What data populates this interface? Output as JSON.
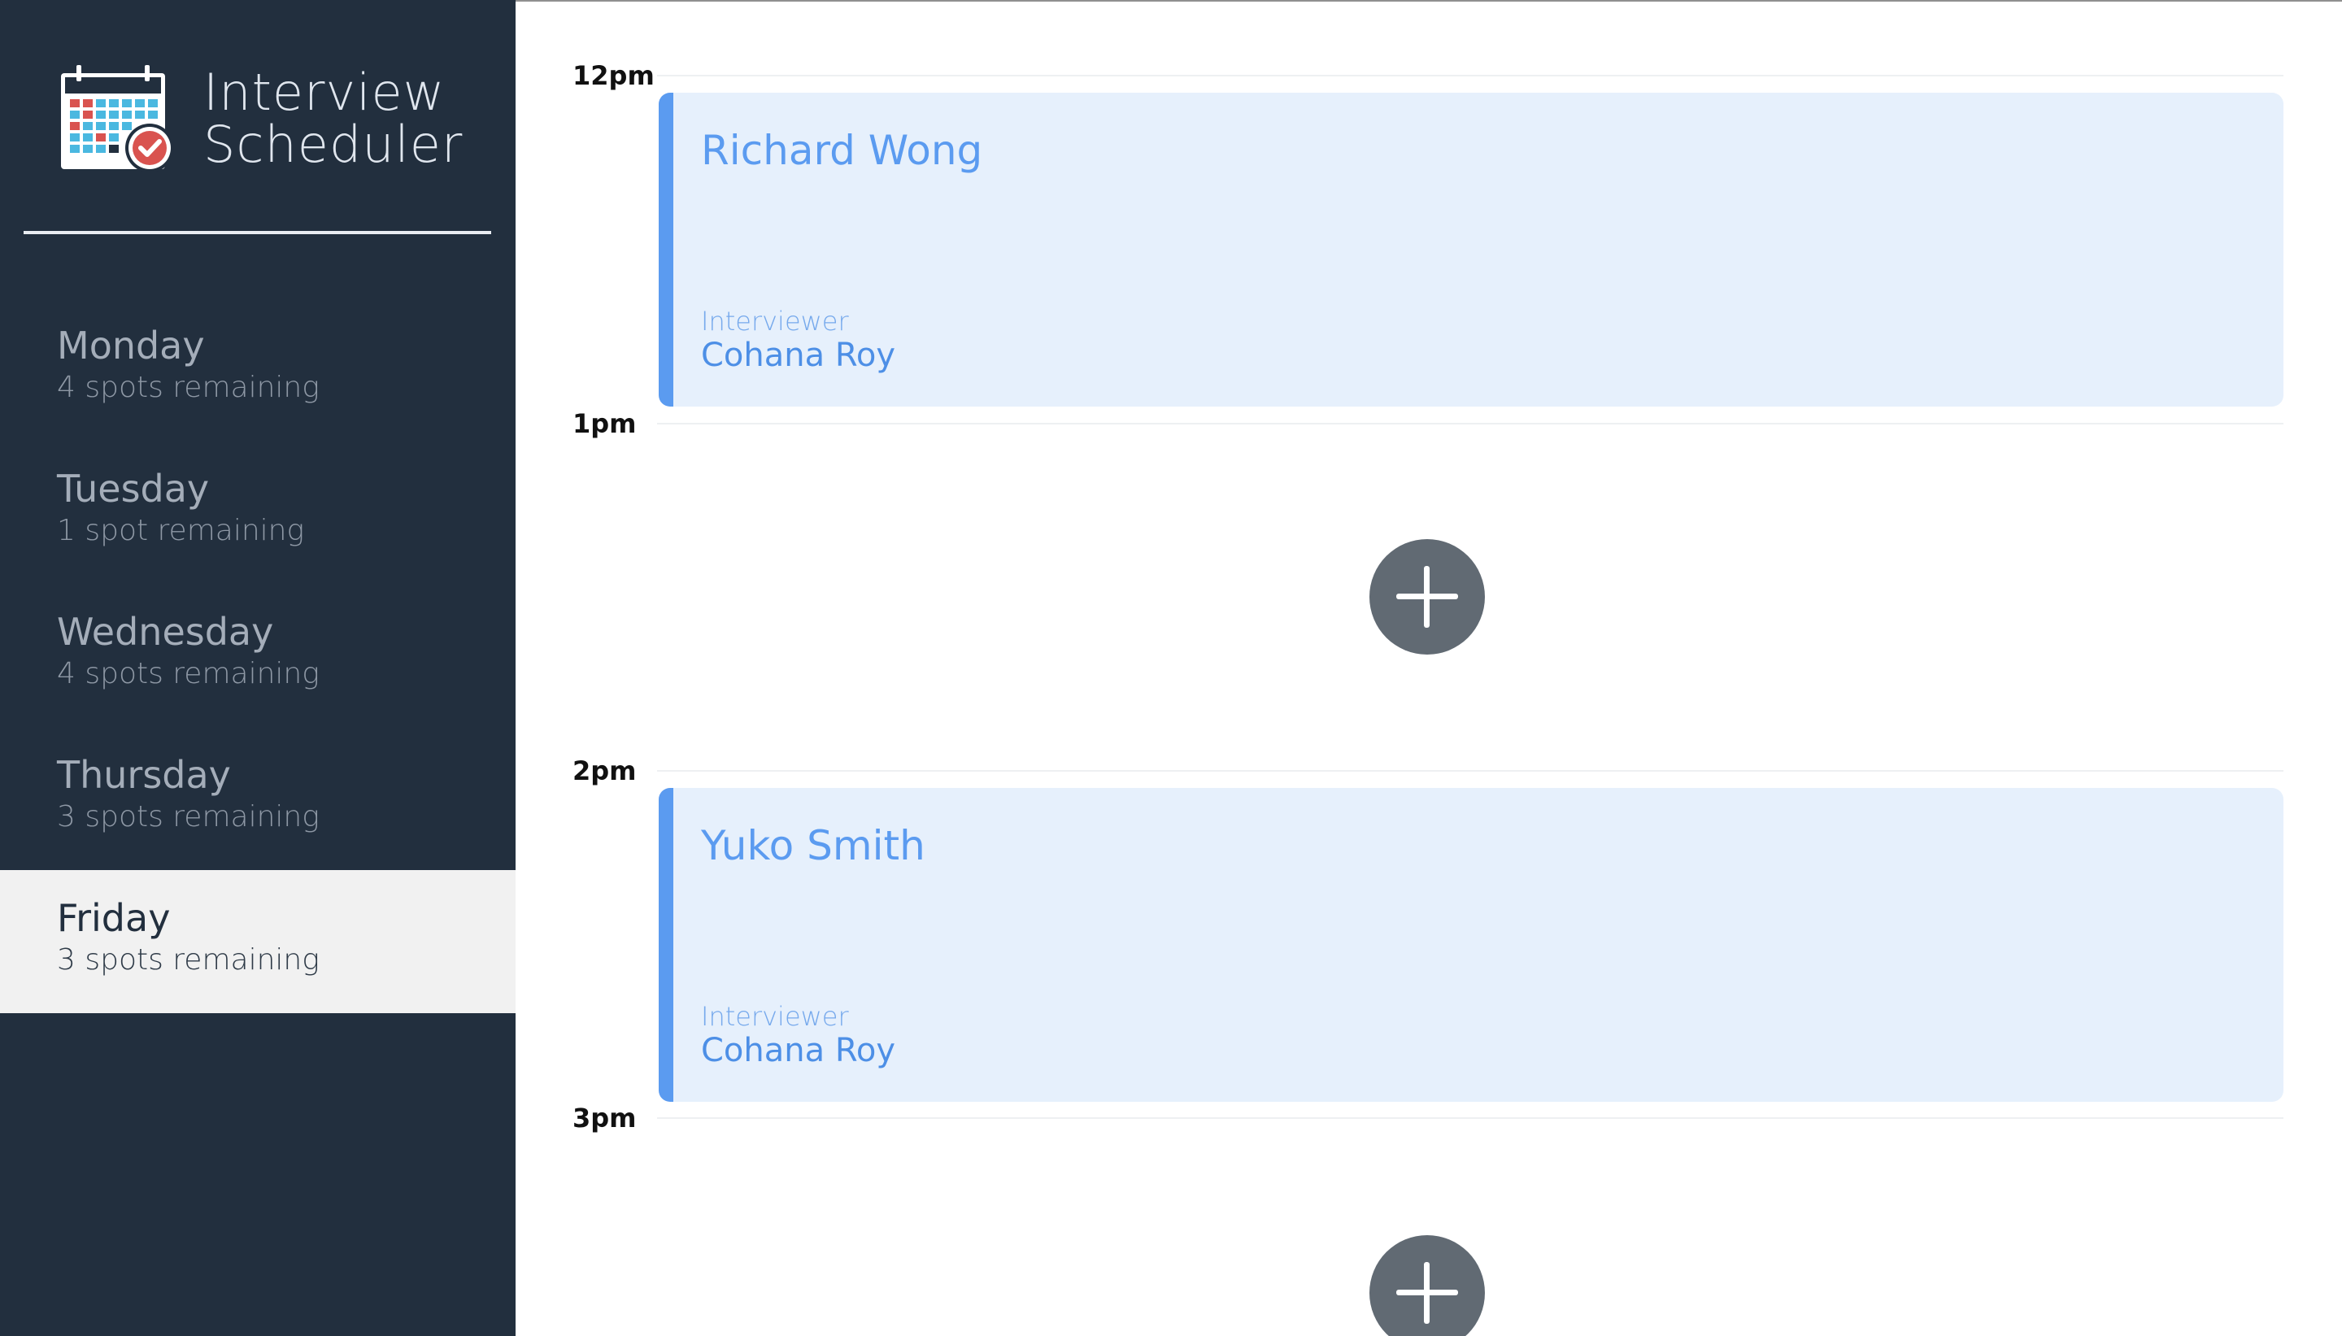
{
  "app": {
    "title_line1": "Interview",
    "title_line2": "Scheduler",
    "logo_icon": "calendar-check-icon"
  },
  "sidebar": {
    "days": [
      {
        "name": "Monday",
        "spots": "4 spots remaining",
        "selected": false
      },
      {
        "name": "Tuesday",
        "spots": "1 spot remaining",
        "selected": false
      },
      {
        "name": "Wednesday",
        "spots": "4 spots remaining",
        "selected": false
      },
      {
        "name": "Thursday",
        "spots": "3 spots remaining",
        "selected": false
      },
      {
        "name": "Friday",
        "spots": "3 spots remaining",
        "selected": true
      }
    ]
  },
  "schedule": {
    "slots": [
      {
        "time": "12pm",
        "booked": true,
        "student": "Richard Wong",
        "interviewer_label": "Interviewer",
        "interviewer": "Cohana Roy"
      },
      {
        "time": "1pm",
        "booked": false,
        "add_icon": "plus-icon"
      },
      {
        "time": "2pm",
        "booked": true,
        "student": "Yuko Smith",
        "interviewer_label": "Interviewer",
        "interviewer": "Cohana Roy"
      },
      {
        "time": "3pm",
        "booked": false,
        "add_icon": "plus-icon"
      }
    ]
  },
  "colors": {
    "sidebar_bg": "#222f3e",
    "selected_day_bg": "#f1f1f1",
    "appointment_bg": "#e6f0fc",
    "accent_blue": "#5b9bf0",
    "add_button": "#616a73"
  }
}
